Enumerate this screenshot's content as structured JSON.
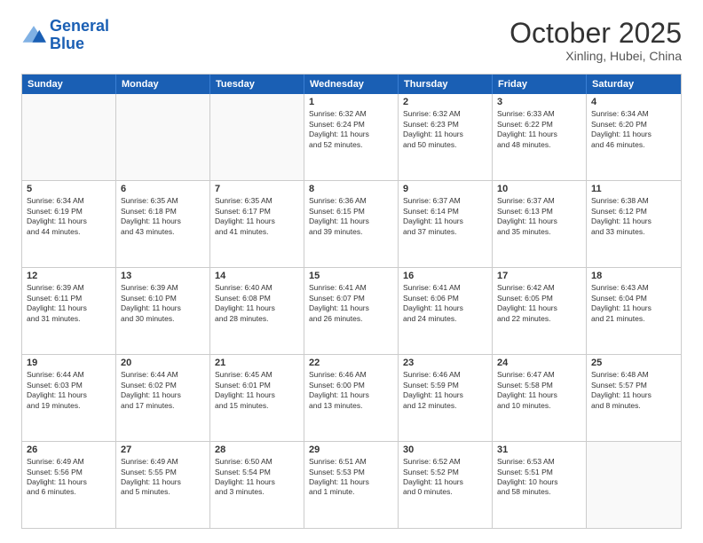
{
  "logo": {
    "text_general": "General",
    "text_blue": "Blue"
  },
  "header": {
    "month": "October 2025",
    "location": "Xinling, Hubei, China"
  },
  "weekdays": [
    "Sunday",
    "Monday",
    "Tuesday",
    "Wednesday",
    "Thursday",
    "Friday",
    "Saturday"
  ],
  "rows": [
    [
      {
        "day": "",
        "info": "",
        "empty": true
      },
      {
        "day": "",
        "info": "",
        "empty": true
      },
      {
        "day": "",
        "info": "",
        "empty": true
      },
      {
        "day": "1",
        "info": "Sunrise: 6:32 AM\nSunset: 6:24 PM\nDaylight: 11 hours\nand 52 minutes."
      },
      {
        "day": "2",
        "info": "Sunrise: 6:32 AM\nSunset: 6:23 PM\nDaylight: 11 hours\nand 50 minutes."
      },
      {
        "day": "3",
        "info": "Sunrise: 6:33 AM\nSunset: 6:22 PM\nDaylight: 11 hours\nand 48 minutes."
      },
      {
        "day": "4",
        "info": "Sunrise: 6:34 AM\nSunset: 6:20 PM\nDaylight: 11 hours\nand 46 minutes."
      }
    ],
    [
      {
        "day": "5",
        "info": "Sunrise: 6:34 AM\nSunset: 6:19 PM\nDaylight: 11 hours\nand 44 minutes."
      },
      {
        "day": "6",
        "info": "Sunrise: 6:35 AM\nSunset: 6:18 PM\nDaylight: 11 hours\nand 43 minutes."
      },
      {
        "day": "7",
        "info": "Sunrise: 6:35 AM\nSunset: 6:17 PM\nDaylight: 11 hours\nand 41 minutes."
      },
      {
        "day": "8",
        "info": "Sunrise: 6:36 AM\nSunset: 6:15 PM\nDaylight: 11 hours\nand 39 minutes."
      },
      {
        "day": "9",
        "info": "Sunrise: 6:37 AM\nSunset: 6:14 PM\nDaylight: 11 hours\nand 37 minutes."
      },
      {
        "day": "10",
        "info": "Sunrise: 6:37 AM\nSunset: 6:13 PM\nDaylight: 11 hours\nand 35 minutes."
      },
      {
        "day": "11",
        "info": "Sunrise: 6:38 AM\nSunset: 6:12 PM\nDaylight: 11 hours\nand 33 minutes."
      }
    ],
    [
      {
        "day": "12",
        "info": "Sunrise: 6:39 AM\nSunset: 6:11 PM\nDaylight: 11 hours\nand 31 minutes."
      },
      {
        "day": "13",
        "info": "Sunrise: 6:39 AM\nSunset: 6:10 PM\nDaylight: 11 hours\nand 30 minutes."
      },
      {
        "day": "14",
        "info": "Sunrise: 6:40 AM\nSunset: 6:08 PM\nDaylight: 11 hours\nand 28 minutes."
      },
      {
        "day": "15",
        "info": "Sunrise: 6:41 AM\nSunset: 6:07 PM\nDaylight: 11 hours\nand 26 minutes."
      },
      {
        "day": "16",
        "info": "Sunrise: 6:41 AM\nSunset: 6:06 PM\nDaylight: 11 hours\nand 24 minutes."
      },
      {
        "day": "17",
        "info": "Sunrise: 6:42 AM\nSunset: 6:05 PM\nDaylight: 11 hours\nand 22 minutes."
      },
      {
        "day": "18",
        "info": "Sunrise: 6:43 AM\nSunset: 6:04 PM\nDaylight: 11 hours\nand 21 minutes."
      }
    ],
    [
      {
        "day": "19",
        "info": "Sunrise: 6:44 AM\nSunset: 6:03 PM\nDaylight: 11 hours\nand 19 minutes."
      },
      {
        "day": "20",
        "info": "Sunrise: 6:44 AM\nSunset: 6:02 PM\nDaylight: 11 hours\nand 17 minutes."
      },
      {
        "day": "21",
        "info": "Sunrise: 6:45 AM\nSunset: 6:01 PM\nDaylight: 11 hours\nand 15 minutes."
      },
      {
        "day": "22",
        "info": "Sunrise: 6:46 AM\nSunset: 6:00 PM\nDaylight: 11 hours\nand 13 minutes."
      },
      {
        "day": "23",
        "info": "Sunrise: 6:46 AM\nSunset: 5:59 PM\nDaylight: 11 hours\nand 12 minutes."
      },
      {
        "day": "24",
        "info": "Sunrise: 6:47 AM\nSunset: 5:58 PM\nDaylight: 11 hours\nand 10 minutes."
      },
      {
        "day": "25",
        "info": "Sunrise: 6:48 AM\nSunset: 5:57 PM\nDaylight: 11 hours\nand 8 minutes."
      }
    ],
    [
      {
        "day": "26",
        "info": "Sunrise: 6:49 AM\nSunset: 5:56 PM\nDaylight: 11 hours\nand 6 minutes."
      },
      {
        "day": "27",
        "info": "Sunrise: 6:49 AM\nSunset: 5:55 PM\nDaylight: 11 hours\nand 5 minutes."
      },
      {
        "day": "28",
        "info": "Sunrise: 6:50 AM\nSunset: 5:54 PM\nDaylight: 11 hours\nand 3 minutes."
      },
      {
        "day": "29",
        "info": "Sunrise: 6:51 AM\nSunset: 5:53 PM\nDaylight: 11 hours\nand 1 minute."
      },
      {
        "day": "30",
        "info": "Sunrise: 6:52 AM\nSunset: 5:52 PM\nDaylight: 11 hours\nand 0 minutes."
      },
      {
        "day": "31",
        "info": "Sunrise: 6:53 AM\nSunset: 5:51 PM\nDaylight: 10 hours\nand 58 minutes."
      },
      {
        "day": "",
        "info": "",
        "empty": true
      }
    ]
  ]
}
